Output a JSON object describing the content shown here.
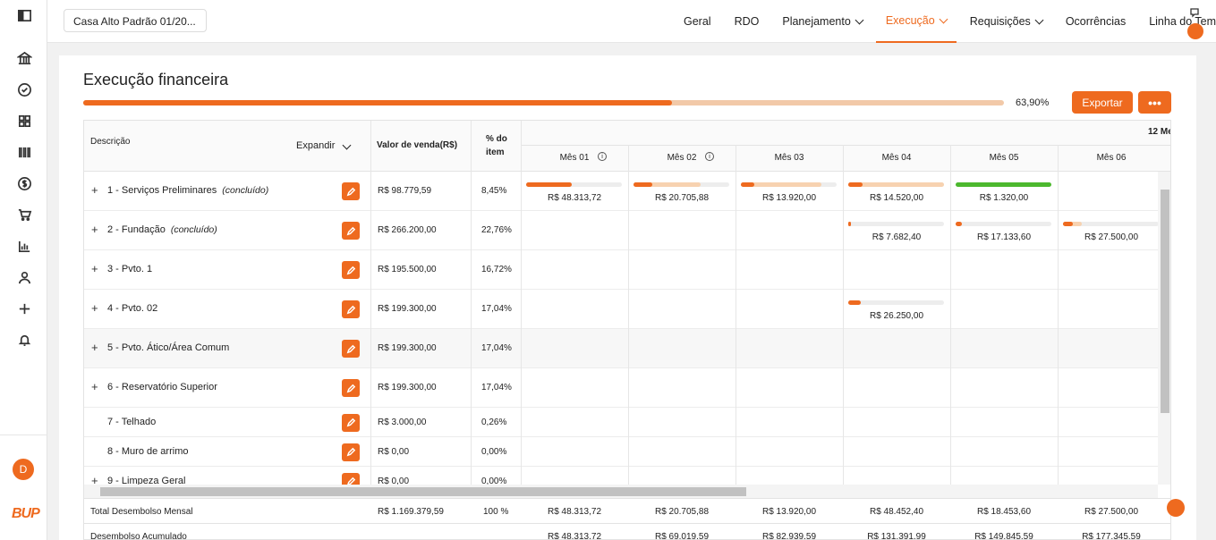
{
  "sidebar": {
    "avatar_initial": "D",
    "brand": "BUP",
    "icons": [
      "toggle-sidebar-icon",
      "bank-icon",
      "check-circle-icon",
      "grid-icon",
      "barcode-icon",
      "dollar-icon",
      "cart-icon",
      "chart-icon",
      "user-icon",
      "plus-icon",
      "bell-icon"
    ]
  },
  "topbar": {
    "project": "Casa Alto Padrão 01/20...",
    "nav": [
      {
        "label": "Geral"
      },
      {
        "label": "RDO"
      },
      {
        "label": "Planejamento",
        "dropdown": true
      },
      {
        "label": "Execução",
        "dropdown": true,
        "active": true
      },
      {
        "label": "Requisições",
        "dropdown": true
      },
      {
        "label": "Ocorrências"
      },
      {
        "label": "Linha do Tempo"
      }
    ]
  },
  "page": {
    "title": "Execução financeira",
    "progress_pct": 63.9,
    "progress_label": "63,90%",
    "export_label": "Exportar",
    "more_label": "•••"
  },
  "table": {
    "headers": {
      "descricao": "Descrição",
      "expandir": "Expandir",
      "valor": "Valor de venda(R$)",
      "pct_a": "% do",
      "pct_b": "item",
      "group": "12 Me"
    },
    "months": [
      {
        "label": "Mês 01",
        "info": true
      },
      {
        "label": "Mês 02",
        "info": true
      },
      {
        "label": "Mês 03"
      },
      {
        "label": "Mês 04"
      },
      {
        "label": "Mês 05"
      },
      {
        "label": "Mês 06"
      }
    ],
    "rows": [
      {
        "plus": true,
        "label": "1 - Serviços Preliminares",
        "tag": "(concluído)",
        "valor": "R$ 98.779,59",
        "pct": "8,45%",
        "cells": [
          {
            "v": "R$ 48.313,72",
            "bars": [
              0.48,
              0
            ]
          },
          {
            "v": "R$ 20.705,88",
            "bars": [
              0.2,
              0.5
            ]
          },
          {
            "v": "R$ 13.920,00",
            "bars": [
              0.14,
              0.7
            ]
          },
          {
            "v": "R$ 14.520,00",
            "bars": [
              0.15,
              0.85
            ]
          },
          {
            "v": "R$ 1.320,00",
            "green": true
          },
          null
        ]
      },
      {
        "plus": true,
        "label": "2 - Fundação",
        "tag": "(concluído)",
        "valor": "R$ 266.200,00",
        "pct": "22,76%",
        "cells": [
          null,
          null,
          null,
          {
            "v": "R$ 7.682,40",
            "bars": [
              0.03,
              0
            ]
          },
          {
            "v": "R$ 17.133,60",
            "bars": [
              0.07,
              0
            ]
          },
          {
            "v": "R$ 27.500,00",
            "bars": [
              0.1,
              0.1
            ]
          }
        ]
      },
      {
        "plus": true,
        "label": "3 - Pvto. 1",
        "tag": "",
        "valor": "R$ 195.500,00",
        "pct": "16,72%",
        "cells": [
          null,
          null,
          null,
          null,
          null,
          null
        ]
      },
      {
        "plus": true,
        "label": "4 - Pvto. 02",
        "tag": "",
        "valor": "R$ 199.300,00",
        "pct": "17,04%",
        "cells": [
          null,
          null,
          null,
          {
            "v": "R$ 26.250,00",
            "bars": [
              0.13,
              0
            ]
          },
          null,
          null
        ]
      },
      {
        "plus": true,
        "label": "5 - Pvto. Ático/Área Comum",
        "tag": "",
        "valor": "R$ 199.300,00",
        "pct": "17,04%",
        "cells": [
          null,
          null,
          null,
          null,
          null,
          null
        ]
      },
      {
        "plus": true,
        "label": "6 - Reservatório Superior",
        "tag": "",
        "valor": "R$ 199.300,00",
        "pct": "17,04%",
        "cells": [
          null,
          null,
          null,
          null,
          null,
          null
        ]
      },
      {
        "plus": false,
        "label": "7 - Telhado",
        "tag": "",
        "valor": "R$ 3.000,00",
        "pct": "0,26%",
        "cells": [
          null,
          null,
          null,
          null,
          null,
          null
        ]
      },
      {
        "plus": false,
        "label": "8 - Muro de arrimo",
        "tag": "",
        "valor": "R$ 0,00",
        "pct": "0,00%",
        "cells": [
          null,
          null,
          null,
          null,
          null,
          null
        ]
      },
      {
        "plus": true,
        "label": "9 - Limpeza Geral",
        "tag": "",
        "valor": "R$ 0,00",
        "pct": "0,00%",
        "cells": [
          null,
          null,
          null,
          null,
          null,
          null
        ]
      }
    ],
    "footer": [
      {
        "label": "Total Desembolso Mensal",
        "valor": "R$ 1.169.379,59",
        "pct": "100 %",
        "months": [
          "R$ 48.313,72",
          "R$ 20.705,88",
          "R$ 13.920,00",
          "R$ 48.452,40",
          "R$ 18.453,60",
          "R$ 27.500,00"
        ]
      },
      {
        "label": "Desembolso Acumulado",
        "valor": "",
        "pct": "",
        "months": [
          "R$ 48.313,72",
          "R$ 69.019,59",
          "R$ 82.939,59",
          "R$ 131.391,99",
          "R$ 149.845,59",
          "R$ 177.345,59"
        ]
      }
    ]
  },
  "colors": {
    "accent": "#ee6a1f",
    "accent_light": "#f7d2b0",
    "green": "#4cb82e"
  }
}
